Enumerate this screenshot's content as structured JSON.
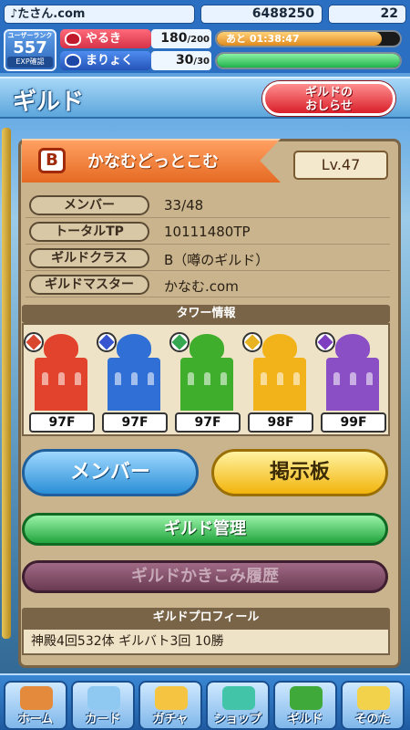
{
  "status": {
    "username": "♪たさん.com",
    "coins": "6488250",
    "gems": "22"
  },
  "hud": {
    "rank_label": "ユーザーランク",
    "rank_value": "557",
    "exp_label": "EXP確認",
    "stamina_label": "やるき",
    "stamina_value": "180",
    "stamina_max": "/200",
    "stamina_timer": "あと 01:38:47",
    "stamina_fraction": 0.9,
    "magic_label": "まりょく",
    "magic_value": "30",
    "magic_max": "/30",
    "magic_fraction": 1.0
  },
  "header": {
    "title": "ギルド",
    "news_button": "ギルドの\nおしらせ"
  },
  "guild": {
    "class_letter": "B",
    "name": "かなむどっとこむ",
    "level": "Lv.47",
    "info": [
      {
        "key": "メンバー",
        "value": "33/48"
      },
      {
        "key": "トータルTP",
        "value": "10111480TP"
      },
      {
        "key": "ギルドクラス",
        "value": "B（噂のギルド）"
      },
      {
        "key": "ギルドマスター",
        "value": "かなむ.com"
      }
    ]
  },
  "towers": {
    "header": "タワー情報",
    "items": [
      {
        "floor": "97F",
        "color": "#e2432c",
        "gem": "#d9472e"
      },
      {
        "floor": "97F",
        "color": "#2f6fd6",
        "gem": "#3856d0"
      },
      {
        "floor": "97F",
        "color": "#3fae2c",
        "gem": "#36a852"
      },
      {
        "floor": "98F",
        "color": "#f2b21a",
        "gem": "#e8b320"
      },
      {
        "floor": "99F",
        "color": "#8a4fc4",
        "gem": "#7d3fc0"
      }
    ]
  },
  "buttons": {
    "members": "メンバー",
    "board": "掲示板",
    "manage": "ギルド管理",
    "history": "ギルドかきこみ履歴"
  },
  "profile": {
    "header": "ギルドプロフィール",
    "text": "神殿4回532体 ギルバト3回 10勝"
  },
  "nav": {
    "items": [
      {
        "label": "ホーム",
        "icon": "home-icon",
        "color": "#e48a3c"
      },
      {
        "label": "カード",
        "icon": "card-icon",
        "color": "#8fc8f0"
      },
      {
        "label": "ガチャ",
        "icon": "gacha-icon",
        "color": "#f5c542"
      },
      {
        "label": "ショップ",
        "icon": "shop-icon",
        "color": "#42c4a8"
      },
      {
        "label": "ギルド",
        "icon": "guild-icon",
        "color": "#3faa3a"
      },
      {
        "label": "そのた",
        "icon": "other-icon",
        "color": "#f2d24a"
      }
    ]
  }
}
